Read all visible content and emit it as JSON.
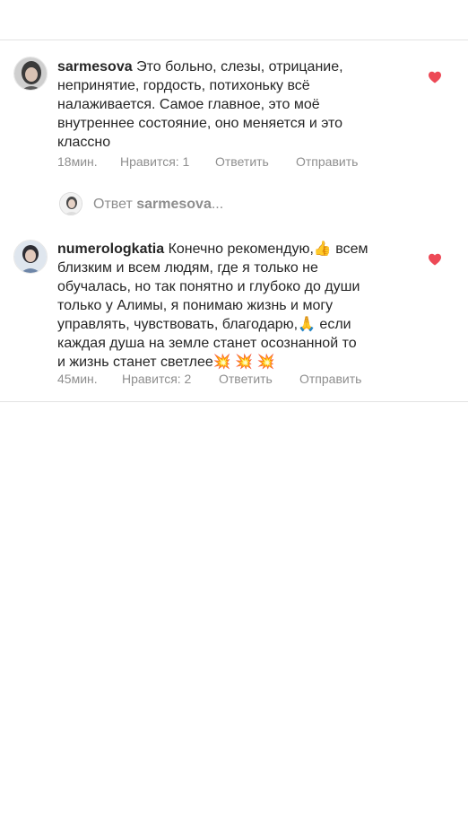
{
  "comments": [
    {
      "username": "sarmesova",
      "text": " Это больно,  слезы,  отрицание,\nнепринятие, гордость,  потихоньку всё\nналаживается.  Самое главное, это моё\nвнутреннее состояние, оно меняется и это\nклассно",
      "time": "18мин.",
      "likes": "Нравится: 1",
      "reply": "Ответить",
      "send": "Отправить",
      "liked": true,
      "avatar_icon": "user-avatar-photo"
    },
    {
      "username": "numerologkatia",
      "text": " Конечно рекомендую,👍 всем\nблизким и всем людям, где я только не\nобучалась, но так понятно и глубоко до души\nтолько у Алимы, я понимаю жизнь и могу\nуправлять, чувствовать, благодарю,🙏 если\nкаждая душа на земле станет осознанной то\nи жизнь станет светлее💥 💥 💥",
      "time": "45мин.",
      "likes": "Нравится: 2",
      "reply": "Ответить",
      "send": "Отправить",
      "liked": true,
      "avatar_icon": "user-avatar-photo"
    }
  ],
  "reply_bar": {
    "prefix": "Ответ ",
    "username": "sarmesova",
    "ellipsis": "..."
  },
  "colors": {
    "text": "#262626",
    "meta": "#8e8e8e",
    "like": "#ed4956",
    "divider": "#e3e3e3"
  }
}
